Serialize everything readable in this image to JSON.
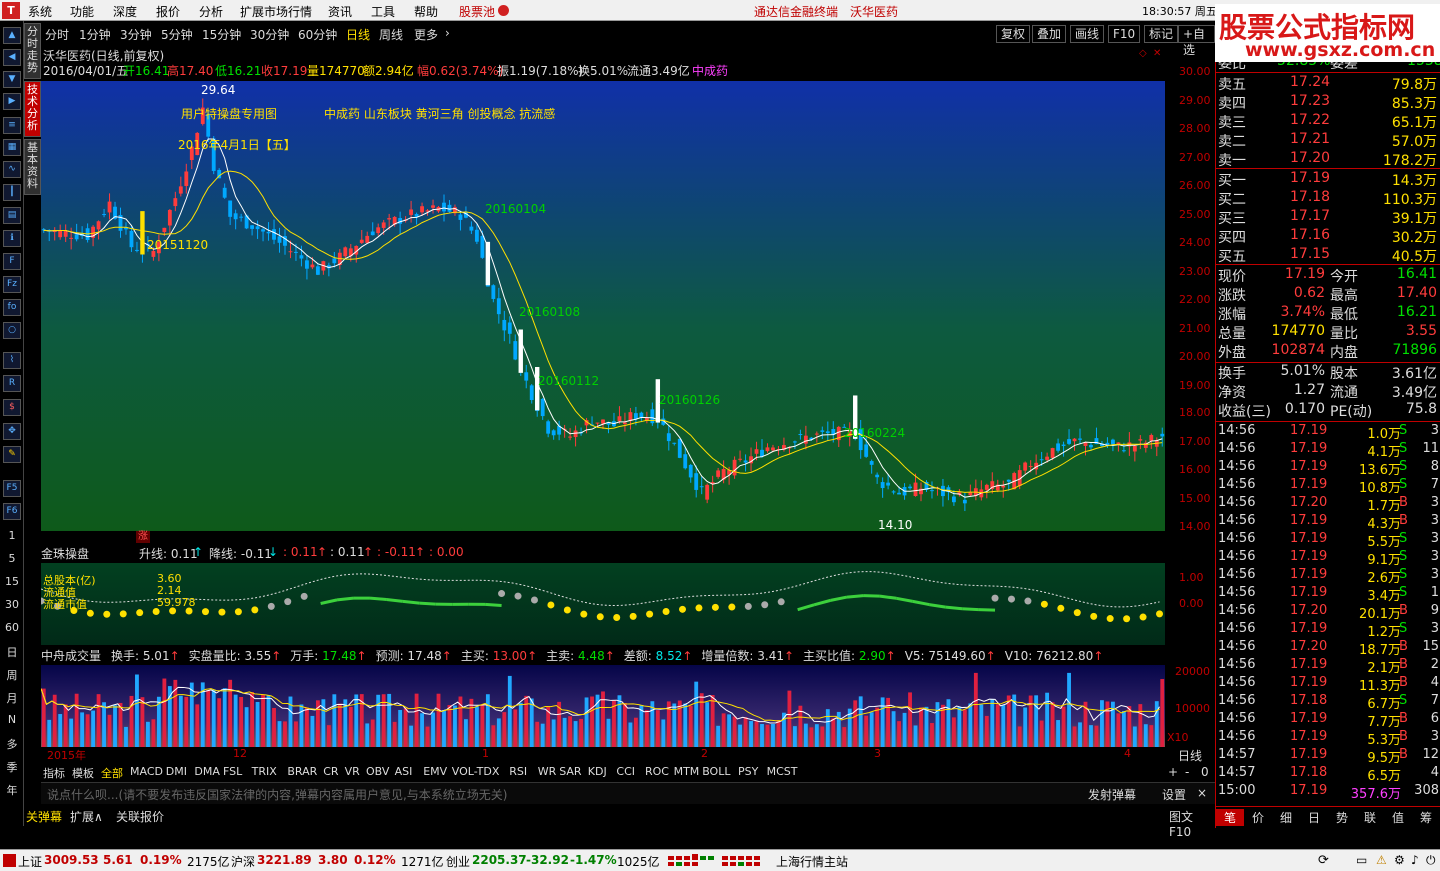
{
  "menubar": {
    "items": [
      "系统",
      "功能",
      "深度",
      "报价",
      "分析",
      "扩展市场行情",
      "资讯",
      "工具",
      "帮助"
    ],
    "stock_pool": "股票池",
    "center_text": "通达信金融终端",
    "center_stock": "沃华医药",
    "clock": "18:30:57 周五"
  },
  "vtabs": [
    "分时走势",
    "技术分析",
    "基本资料"
  ],
  "left_icons": [
    "up-icon",
    "left-icon",
    "down-icon",
    "right-icon",
    "list-icon",
    "grid-icon",
    "line-icon",
    "candles-icon",
    "table-icon",
    "info-icon",
    "f10-icon",
    "fiz-icon",
    "f10b-icon",
    "circle-icon",
    "chart-icon",
    "rsi-icon",
    "dollar-icon",
    "move-icon",
    "pen-icon",
    "f5-icon",
    "f6-icon"
  ],
  "periods": {
    "labels": [
      "1",
      "5",
      "15",
      "30",
      "60",
      "日",
      "周",
      "月",
      "N",
      "多",
      "季",
      "年"
    ]
  },
  "periodbar": {
    "items": [
      "分时",
      "1分钟",
      "3分钟",
      "5分钟",
      "15分钟",
      "30分钟",
      "60分钟",
      "日线",
      "周线",
      "更多"
    ],
    "active": "日线",
    "tools": [
      "复权",
      "叠加",
      "画线",
      "F10",
      "标记",
      "+自选"
    ]
  },
  "info": {
    "title": "沃华医药(日线,前复权)",
    "date": "2016/04/01/五",
    "open": "开16.41",
    "high": "高17.40",
    "low": "低16.21",
    "close": "收17.19",
    "vol": "量174770",
    "amount": "额2.94亿",
    "amp_pct": "幅0.62(3.74%)",
    "swing": "振1.19(7.18%)",
    "turnover": "换5.01%",
    "float": "流通3.49亿",
    "sector": "中成药"
  },
  "chart": {
    "annotations": {
      "special": "用户特操盘专用图",
      "concepts": "中成药  山东板块  黄河三角  创投概念  抗流感",
      "date_hint": "2016年4月1日【五】",
      "peak": "29.64",
      "trough": "14.10",
      "zhang": "涨"
    },
    "dates": [
      {
        "label": "20151120"
      },
      {
        "label": "20160104"
      },
      {
        "label": "20160108"
      },
      {
        "label": "20160112"
      },
      {
        "label": "20160126"
      },
      {
        "label": "20160224"
      }
    ],
    "axis": [
      "30.00",
      "29.00",
      "28.00",
      "27.00",
      "26.00",
      "25.00",
      "24.00",
      "23.00",
      "22.00",
      "21.00",
      "20.00",
      "19.00",
      "18.00",
      "17.00",
      "16.00",
      "15.00",
      "14.00"
    ]
  },
  "panel2": {
    "title": "金珠操盘",
    "up": "升线: 0.11",
    "down": "降线: -0.11",
    "v1": ": 0.11",
    "v2": ": 0.11",
    "v3": ": -0.11",
    "v4": ": 0.00",
    "labels": [
      "总股本(亿)",
      "流通值",
      "流通市值"
    ],
    "vals": [
      "3.60",
      "2.14",
      "59.978"
    ],
    "axis": [
      "1.00",
      "0.00"
    ]
  },
  "panel3": {
    "title": "中舟成交量",
    "fields": [
      {
        "k": "换手: ",
        "v": "5.01",
        "c": "wht"
      },
      {
        "k": "实盘量比: ",
        "v": "3.55",
        "c": "wht"
      },
      {
        "k": "万手: ",
        "v": "17.48",
        "c": "grn"
      },
      {
        "k": "预测: ",
        "v": "17.48",
        "c": "wht"
      },
      {
        "k": "主买: ",
        "v": "13.00",
        "c": "red"
      },
      {
        "k": "主卖: ",
        "v": "4.48",
        "c": "grn"
      },
      {
        "k": "差额: ",
        "v": "8.52",
        "c": "cyn"
      },
      {
        "k": "增量倍数: ",
        "v": "3.41",
        "c": "wht"
      },
      {
        "k": "主买比值: ",
        "v": "2.90",
        "c": "grn"
      },
      {
        "k": "V5: ",
        "v": "75149.60",
        "c": "wht"
      },
      {
        "k": "V10: ",
        "v": "76212.80",
        "c": "wht"
      }
    ],
    "axis": [
      "20000",
      "10000"
    ],
    "unit": "X10"
  },
  "xaxis": {
    "labels": [
      "2015年",
      "12",
      "1",
      "2",
      "3",
      "4"
    ]
  },
  "indbar": {
    "tabs": [
      "指标",
      "模板",
      "全部",
      "MACD",
      "DMI",
      "DMA",
      "FSL",
      "TRIX",
      "BRAR",
      "CR",
      "VR",
      "OBV",
      "ASI",
      "EMV",
      "VOL-TDX",
      "RSI",
      "WR",
      "SAR",
      "KDJ",
      "CCI",
      "ROC",
      "MTM",
      "BOLL",
      "PSY",
      "MCST"
    ],
    "active": "全部",
    "right": [
      "+",
      "-",
      "0"
    ],
    "period": "日线"
  },
  "danmu": {
    "placeholder": "说点什么呗...(请不要发布违反国家法律的内容,弹幕内容属用户意见,与本系统立场无关)",
    "send": "发射弹幕",
    "settings": "设置",
    "close": "×"
  },
  "bottabs": {
    "items": [
      "关弹幕",
      "扩展∧",
      "关联报价"
    ],
    "right": "图文F10"
  },
  "quote": {
    "header": {
      "k": "委比",
      "v": "-52.85%",
      "k2": "委差",
      "v2": "-1538"
    },
    "asks": [
      {
        "label": "卖五",
        "price": "17.24",
        "vol": "79.8万"
      },
      {
        "label": "卖四",
        "price": "17.23",
        "vol": "85.3万"
      },
      {
        "label": "卖三",
        "price": "17.22",
        "vol": "65.1万"
      },
      {
        "label": "卖二",
        "price": "17.21",
        "vol": "57.0万"
      },
      {
        "label": "卖一",
        "price": "17.20",
        "vol": "178.2万"
      }
    ],
    "bids": [
      {
        "label": "买一",
        "price": "17.19",
        "vol": "14.3万"
      },
      {
        "label": "买二",
        "price": "17.18",
        "vol": "110.3万"
      },
      {
        "label": "买三",
        "price": "17.17",
        "vol": "39.1万"
      },
      {
        "label": "买四",
        "price": "17.16",
        "vol": "30.2万"
      },
      {
        "label": "买五",
        "price": "17.15",
        "vol": "40.5万"
      }
    ],
    "stats": [
      {
        "k1": "现价",
        "v1": "17.19",
        "c1": "red",
        "k2": "今开",
        "v2": "16.41",
        "c2": "grn"
      },
      {
        "k1": "涨跌",
        "v1": "0.62",
        "c1": "red",
        "k2": "最高",
        "v2": "17.40",
        "c2": "red"
      },
      {
        "k1": "涨幅",
        "v1": "3.74%",
        "c1": "red",
        "k2": "最低",
        "v2": "16.21",
        "c2": "grn"
      },
      {
        "k1": "总量",
        "v1": "174770",
        "c1": "yel",
        "k2": "量比",
        "v2": "3.55",
        "c2": "red"
      },
      {
        "k1": "外盘",
        "v1": "102874",
        "c1": "red",
        "k2": "内盘",
        "v2": "71896",
        "c2": "grn"
      }
    ],
    "stats2": [
      {
        "k1": "换手",
        "v1": "5.01%",
        "c1": "wht",
        "k2": "股本",
        "v2": "3.61亿",
        "c2": "wht"
      },
      {
        "k1": "净资",
        "v1": "1.27",
        "c1": "wht",
        "k2": "流通",
        "v2": "3.49亿",
        "c2": "wht"
      },
      {
        "k1": "收益(三)",
        "v1": "0.170",
        "c1": "wht",
        "k2": "PE(动)",
        "v2": "75.8",
        "c2": "wht"
      }
    ],
    "ticks": [
      {
        "t": "14:56",
        "p": "17.19",
        "v": "1.0万",
        "s": "S",
        "n": "3"
      },
      {
        "t": "14:56",
        "p": "17.19",
        "v": "4.1万",
        "s": "S",
        "n": "11"
      },
      {
        "t": "14:56",
        "p": "17.19",
        "v": "13.6万",
        "s": "S",
        "n": "8"
      },
      {
        "t": "14:56",
        "p": "17.19",
        "v": "10.8万",
        "s": "S",
        "n": "7"
      },
      {
        "t": "14:56",
        "p": "17.20",
        "v": "1.7万",
        "s": "B",
        "n": "3"
      },
      {
        "t": "14:56",
        "p": "17.19",
        "v": "4.3万",
        "s": "B",
        "n": "3"
      },
      {
        "t": "14:56",
        "p": "17.19",
        "v": "5.5万",
        "s": "S",
        "n": "3"
      },
      {
        "t": "14:56",
        "p": "17.19",
        "v": "9.1万",
        "s": "S",
        "n": "3"
      },
      {
        "t": "14:56",
        "p": "17.19",
        "v": "2.6万",
        "s": "S",
        "n": "3"
      },
      {
        "t": "14:56",
        "p": "17.19",
        "v": "3.4万",
        "s": "S",
        "n": "1"
      },
      {
        "t": "14:56",
        "p": "17.20",
        "v": "20.1万",
        "s": "B",
        "n": "9"
      },
      {
        "t": "14:56",
        "p": "17.19",
        "v": "1.2万",
        "s": "S",
        "n": "3"
      },
      {
        "t": "14:56",
        "p": "17.20",
        "v": "18.7万",
        "s": "B",
        "n": "15"
      },
      {
        "t": "14:56",
        "p": "17.19",
        "v": "2.1万",
        "s": "B",
        "n": "2"
      },
      {
        "t": "14:56",
        "p": "17.19",
        "v": "11.3万",
        "s": "B",
        "n": "4"
      },
      {
        "t": "14:56",
        "p": "17.18",
        "v": "6.7万",
        "s": "S",
        "n": "7"
      },
      {
        "t": "14:56",
        "p": "17.19",
        "v": "7.7万",
        "s": "B",
        "n": "6"
      },
      {
        "t": "14:56",
        "p": "17.19",
        "v": "5.3万",
        "s": "B",
        "n": "3"
      },
      {
        "t": "14:57",
        "p": "17.19",
        "v": "9.5万",
        "s": "B",
        "n": "12"
      },
      {
        "t": "14:57",
        "p": "17.18",
        "v": "6.5万",
        "s": "",
        "n": "4"
      },
      {
        "t": "15:00",
        "p": "17.19",
        "v": "357.6万",
        "s": "",
        "n": "308"
      }
    ],
    "tabs": [
      "笔",
      "价",
      "细",
      "日",
      "势",
      "联",
      "值",
      "筹"
    ]
  },
  "statusbar": {
    "sh": "上证",
    "sh_v": "3009.53",
    "sh_c": "5.61",
    "sh_p": "0.19%",
    "sh_a": "2175亿",
    "hs": "沪深",
    "hs_v": "3221.89",
    "hs_c": "3.80",
    "hs_p": "0.12%",
    "hs_a": "1271亿",
    "cy": "创业",
    "cy_v": "2205.37",
    "cy_c": "-32.92",
    "cy_p": "-1.47%",
    "cy_a": "1025亿",
    "station": "上海行情主站"
  },
  "watermark": {
    "line1": "股票公式指标网",
    "line2": "www.gsxz.com.cn"
  },
  "colors": {
    "up": "#ff3c3c",
    "down": "#00e8e8",
    "ma1": "#ffffff",
    "ma2": "#ffe000"
  }
}
